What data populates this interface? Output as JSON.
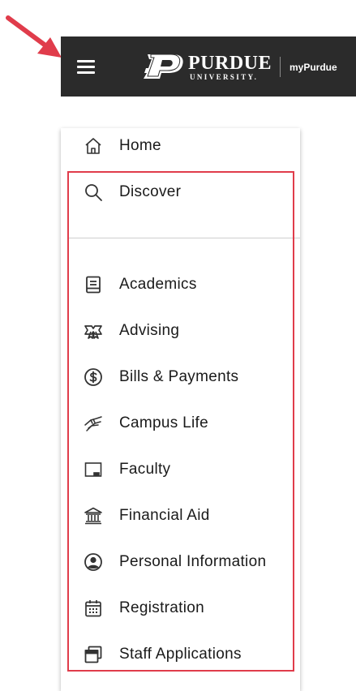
{
  "header": {
    "brand_name": "PURDUE",
    "brand_sub": "UNIVERSITY.",
    "app_name": "myPurdue",
    "background": "#2b2b2b"
  },
  "menu": {
    "items": [
      {
        "label": "Home",
        "icon": "home-icon"
      },
      {
        "label": "Discover",
        "icon": "search-icon"
      },
      {
        "label": "Academics",
        "icon": "book-icon"
      },
      {
        "label": "Advising",
        "icon": "ribbon-icon"
      },
      {
        "label": "Bills & Payments",
        "icon": "dollar-circle-icon"
      },
      {
        "label": "Campus Life",
        "icon": "handshake-icon"
      },
      {
        "label": "Faculty",
        "icon": "chalkboard-icon"
      },
      {
        "label": "Financial Aid",
        "icon": "bank-icon"
      },
      {
        "label": "Personal Information",
        "icon": "user-circle-icon"
      },
      {
        "label": "Registration",
        "icon": "calendar-icon"
      },
      {
        "label": "Staff Applications",
        "icon": "windows-icon"
      }
    ]
  },
  "colors": {
    "annotation_red": "#e03c4b",
    "icon": "#333333"
  }
}
